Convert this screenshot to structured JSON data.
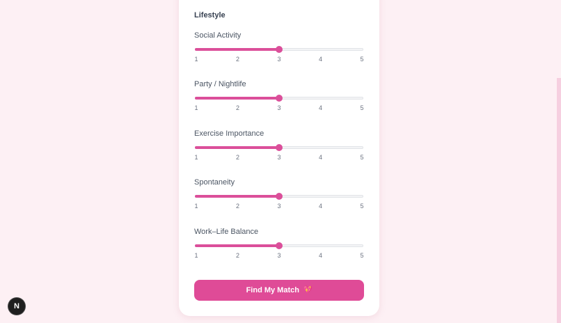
{
  "section": {
    "title": "Lifestyle"
  },
  "sliders": [
    {
      "label": "Social Activity",
      "min": 1,
      "max": 5,
      "value": 3,
      "ticks": [
        "1",
        "2",
        "3",
        "4",
        "5"
      ]
    },
    {
      "label": "Party / Nightlife",
      "min": 1,
      "max": 5,
      "value": 3,
      "ticks": [
        "1",
        "2",
        "3",
        "4",
        "5"
      ]
    },
    {
      "label": "Exercise Importance",
      "min": 1,
      "max": 5,
      "value": 3,
      "ticks": [
        "1",
        "2",
        "3",
        "4",
        "5"
      ]
    },
    {
      "label": "Spontaneity",
      "min": 1,
      "max": 5,
      "value": 3,
      "ticks": [
        "1",
        "2",
        "3",
        "4",
        "5"
      ]
    },
    {
      "label": "Work–Life Balance",
      "min": 1,
      "max": 5,
      "value": 3,
      "ticks": [
        "1",
        "2",
        "3",
        "4",
        "5"
      ]
    }
  ],
  "submit": {
    "label": "Find My Match",
    "icon": "heart-icon",
    "icon_glyph": "💖"
  },
  "badge": {
    "label": "N",
    "icon": "nextjs-icon"
  },
  "colors": {
    "accent": "#db4f9a",
    "background": "#fdf0f4",
    "card": "#ffffff"
  }
}
